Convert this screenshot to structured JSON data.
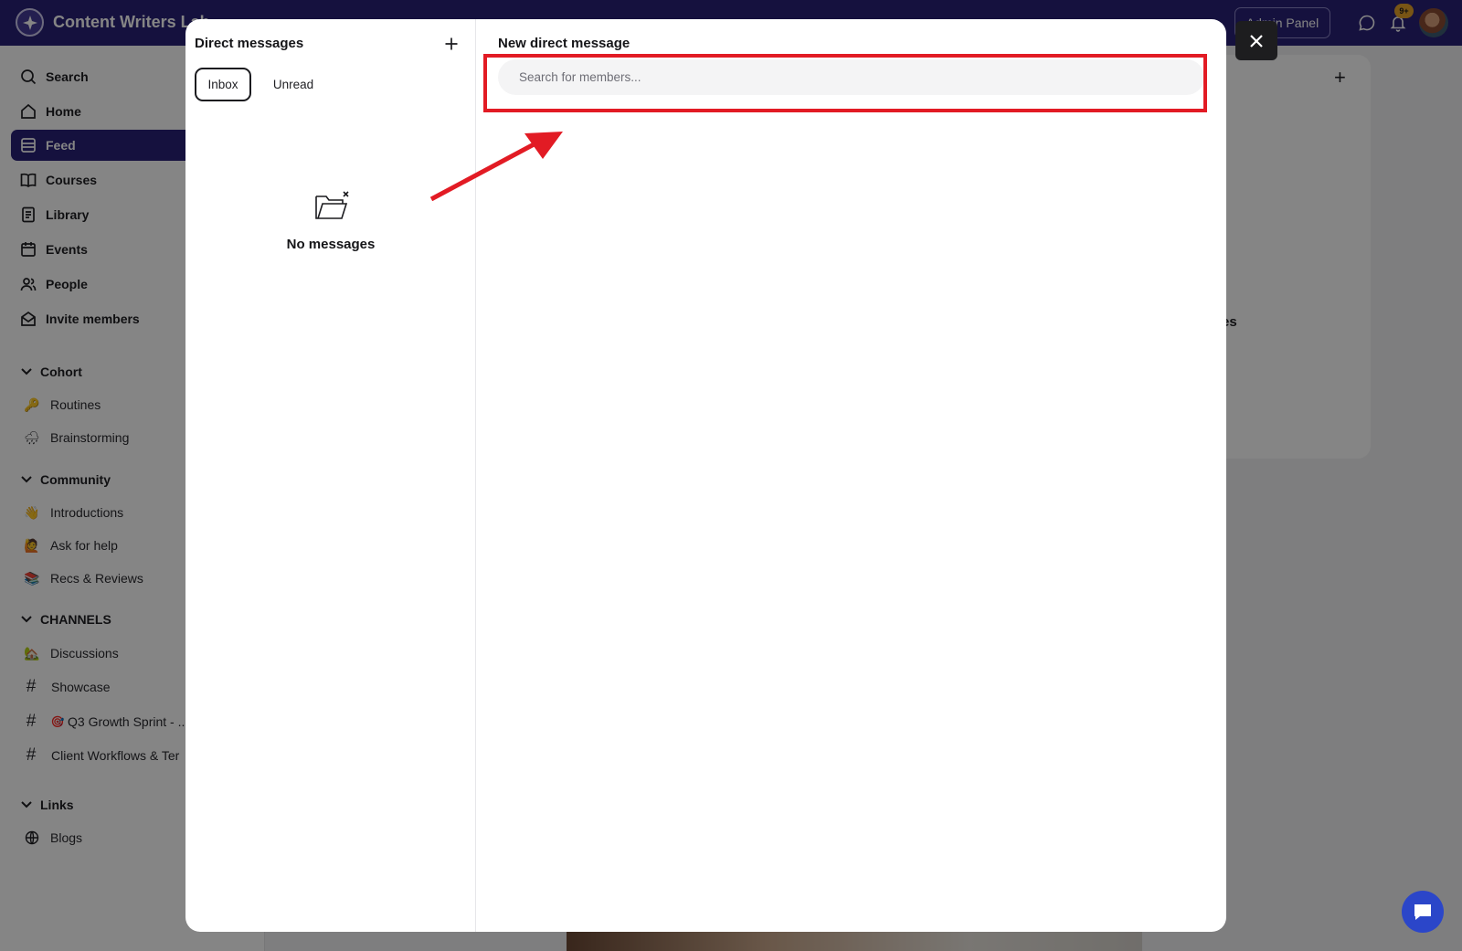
{
  "app": {
    "brand_name": "Content Writers Lab",
    "admin_button": "Admin Panel",
    "notification_count": "9+"
  },
  "sidebar": {
    "nav": [
      {
        "label": "Search",
        "icon": "search-icon"
      },
      {
        "label": "Home",
        "icon": "home-icon"
      },
      {
        "label": "Feed",
        "icon": "feed-icon",
        "active": true
      },
      {
        "label": "Courses",
        "icon": "book-icon"
      },
      {
        "label": "Library",
        "icon": "library-icon"
      },
      {
        "label": "Events",
        "icon": "calendar-icon"
      },
      {
        "label": "People",
        "icon": "people-icon"
      },
      {
        "label": "Invite members",
        "icon": "envelope-icon"
      }
    ],
    "sections": [
      {
        "title": "Cohort",
        "items": [
          {
            "label": "Routines",
            "icon": "key-emoji"
          },
          {
            "label": "Brainstorming",
            "icon": "cloud-emoji"
          }
        ]
      },
      {
        "title": "Community",
        "items": [
          {
            "label": "Introductions",
            "icon": "wave-emoji"
          },
          {
            "label": "Ask for help",
            "icon": "raised-hand-emoji"
          },
          {
            "label": "Recs & Reviews",
            "icon": "books-emoji"
          }
        ]
      },
      {
        "title": "CHANNELS",
        "items": [
          {
            "label": "Discussions",
            "icon": "house-emoji"
          },
          {
            "label": "Showcase",
            "icon": "hash-icon"
          },
          {
            "label": "Q3 Growth Sprint - ...",
            "icon": "hash-icon"
          },
          {
            "label": "Client Workflows & Ter",
            "icon": "hash-icon"
          }
        ]
      },
      {
        "title": "Links",
        "items": [
          {
            "label": "Blogs",
            "icon": "globe-icon"
          }
        ]
      }
    ]
  },
  "background": {
    "right_card_text": "es"
  },
  "modal": {
    "dm_title": "Direct messages",
    "tabs": {
      "inbox": "Inbox",
      "unread": "Unread"
    },
    "empty_state": "No messages",
    "new_dm_title": "New direct message",
    "search_placeholder": "Search for members..."
  },
  "annotation": {
    "highlight_color": "#e21b24"
  }
}
